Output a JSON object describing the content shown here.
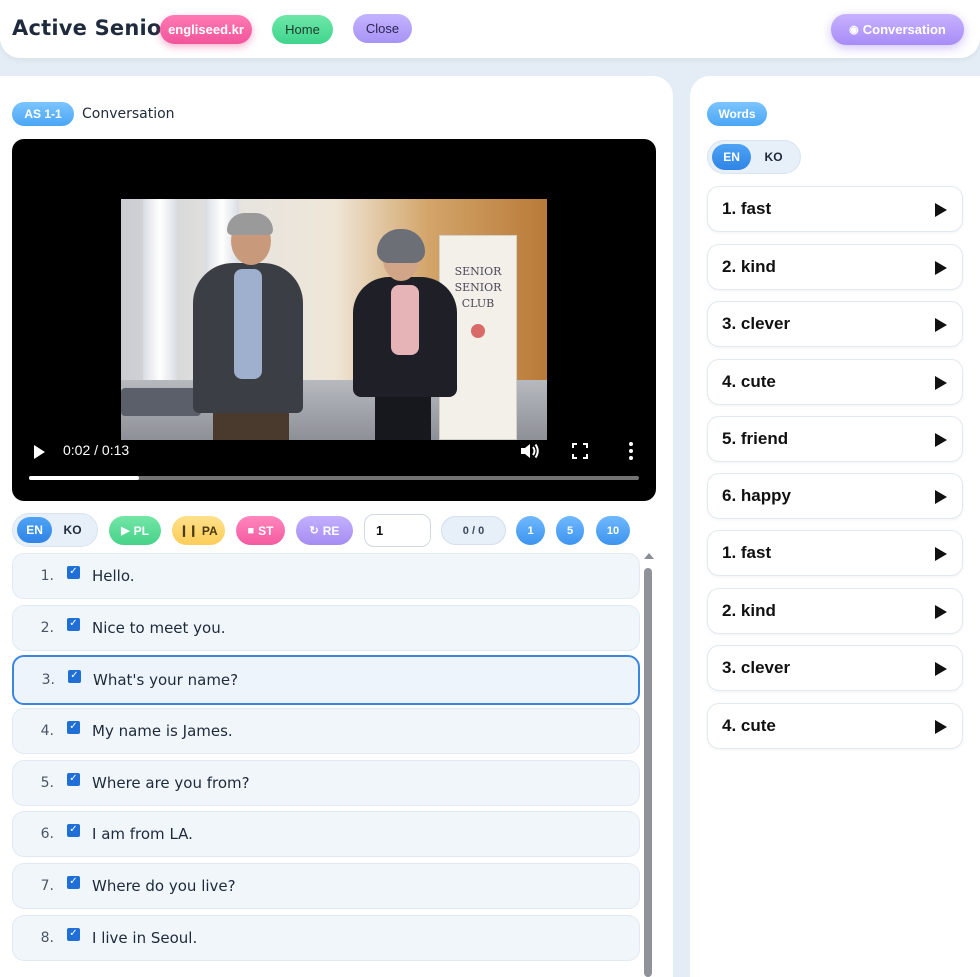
{
  "header": {
    "title": "Active Senior",
    "engliseed_label": "engliseed.kr",
    "home_label": "Home",
    "close_label": "Close",
    "conversation_label": "Conversation",
    "conversation_icon": "speech-bubble-icon"
  },
  "lesson": {
    "badge": "AS 1-1",
    "title": "Conversation"
  },
  "video": {
    "time": "0:02 / 0:13",
    "progress_fraction": 0.18,
    "poster_sign": [
      "SENIOR",
      "SENIOR",
      "CLUB"
    ]
  },
  "controls": {
    "lang_en": "EN",
    "lang_ko": "KO",
    "play_label": "PL",
    "pause_label": "PA",
    "stop_label": "ST",
    "repeat_label": "RE",
    "repeat_value": "1",
    "count": "0 / 0",
    "speed_1": "1",
    "speed_5": "5",
    "speed_10": "10"
  },
  "sentences": [
    {
      "num": "1.",
      "text": "Hello.",
      "checked": true
    },
    {
      "num": "2.",
      "text": "Nice to meet you.",
      "checked": true
    },
    {
      "num": "3.",
      "text": "What's your name?",
      "checked": true,
      "active": true
    },
    {
      "num": "4.",
      "text": "My name is James.",
      "checked": true
    },
    {
      "num": "5.",
      "text": "Where are you from?",
      "checked": true
    },
    {
      "num": "6.",
      "text": "I am from LA.",
      "checked": true
    },
    {
      "num": "7.",
      "text": "Where do you live?",
      "checked": true
    },
    {
      "num": "8.",
      "text": "I live in Seoul.",
      "checked": true
    }
  ],
  "words": {
    "badge": "Words",
    "lang_en": "EN",
    "lang_ko": "KO",
    "items": [
      "1. fast",
      "2. kind",
      "3. clever",
      "4. cute",
      "5. friend",
      "6. happy",
      "1. fast",
      "2. kind",
      "3. clever",
      "4. cute"
    ]
  },
  "colors": {
    "accent_blue": "#2f84e6",
    "engliseed_pink": "#f2559a",
    "home_green": "#3fd58d",
    "close_purple": "#a893f5",
    "pause_yellow": "#fccd58"
  }
}
